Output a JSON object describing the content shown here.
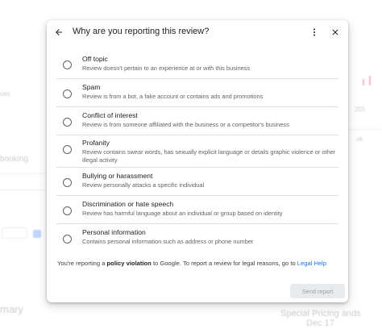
{
  "dialog": {
    "title": "Why are you reporting this review?",
    "options": [
      {
        "label": "Off topic",
        "description": "Review doesn't pertain to an experience at or with this business"
      },
      {
        "label": "Spam",
        "description": "Review is from a bot, a fake account or contains ads and promotions"
      },
      {
        "label": "Conflict of interest",
        "description": "Review is from someone affiliated with the business or a competitor's business"
      },
      {
        "label": "Profanity",
        "description": "Review contains swear words, has sexually explicit language or details graphic violence or other illegal activity"
      },
      {
        "label": "Bullying or harassment",
        "description": "Review personally attacks a specific individual"
      },
      {
        "label": "Discrimination or hate speech",
        "description": "Review has harmful language about an individual or group based on identity"
      },
      {
        "label": "Personal information",
        "description": "Contains personal information such as address or phone number"
      }
    ],
    "footer": {
      "prefix": "You're reporting a ",
      "bold": "policy violation",
      "middle": " to Google. To report a review for legal reasons, go to ",
      "link": "Legal Help"
    },
    "send_button": "Send report"
  },
  "background": {
    "mid_right_label": "Special Pricing ands",
    "date_label": "Dec 17",
    "left_bottom_label": "mary",
    "left_label_1": "booking",
    "left_label_2": "ces",
    "right_label_1": "201",
    "right_label_2": "ok"
  },
  "colors": {
    "link": "#1a73e8",
    "disabled_button_bg": "#e8eaed",
    "disabled_button_text": "#9aa0a6"
  }
}
